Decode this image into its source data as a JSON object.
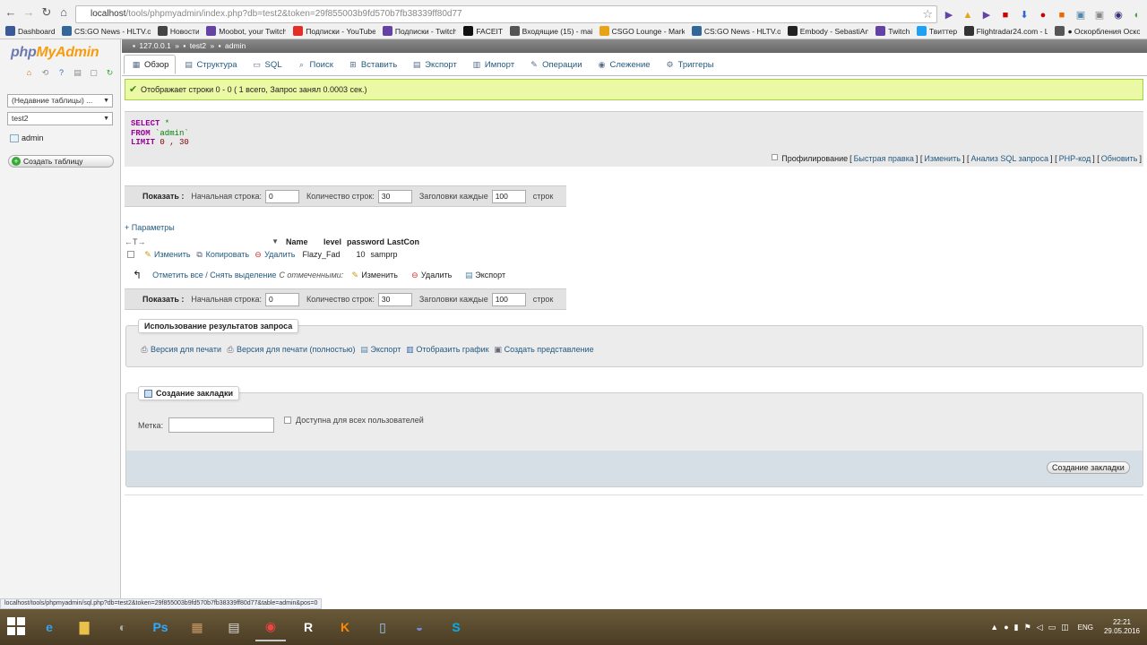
{
  "browser": {
    "url_prefix": "localhost",
    "url_suffix": "/tools/phpmyadmin/index.php?db=test2&token=29f855003b9fd570b7fb38339ff80d77",
    "bookmarks": [
      {
        "label": "Dashboard",
        "color": "#3b5998",
        "icon": "dashboard-icon"
      },
      {
        "label": "CS:GO News - HLTV.o",
        "color": "#336699",
        "icon": "hltv-icon"
      },
      {
        "label": "Новости",
        "color": "#444444",
        "icon": "news-icon"
      },
      {
        "label": "Moobot, your Twitch",
        "color": "#6441a5",
        "icon": "moobot-icon"
      },
      {
        "label": "Подписки - YouTube",
        "color": "#e52d27",
        "icon": "youtube-icon"
      },
      {
        "label": "Подписки - Twitch",
        "color": "#6441a5",
        "icon": "twitch-icon"
      },
      {
        "label": "FACEIT",
        "color": "#111111",
        "icon": "faceit-icon"
      },
      {
        "label": "Входящие (15) - mai",
        "color": "#555555",
        "icon": "mail-icon"
      },
      {
        "label": "CSGO Lounge - Mark",
        "color": "#e8a317",
        "icon": "lounge-icon"
      },
      {
        "label": "CS:GO News - HLTV.o",
        "color": "#336699",
        "icon": "hltv-icon"
      },
      {
        "label": "Embody - SebastiAn",
        "color": "#222222",
        "icon": "play-icon"
      },
      {
        "label": "Twitch",
        "color": "#6441a5",
        "icon": "twitch-icon"
      },
      {
        "label": "Твиттер",
        "color": "#1da1f2",
        "icon": "twitter-icon"
      },
      {
        "label": "Flightradar24.com - L",
        "color": "#333333",
        "icon": "radar-icon"
      },
      {
        "label": "● Оскорбления Оско",
        "color": "#555555",
        "icon": "page-icon"
      }
    ]
  },
  "left": {
    "logo_php": "php",
    "logo_my": "MyAdmin",
    "recent": "(Недавние таблицы) ...",
    "db": "test2",
    "table": "admin",
    "create_table": "Создать таблицу"
  },
  "breadcrumb": {
    "server": "127.0.0.1",
    "db": "test2",
    "table": "admin",
    "sep": "»"
  },
  "tabs": [
    {
      "label": "Обзор",
      "icon": "browse-icon",
      "active": true
    },
    {
      "label": "Структура",
      "icon": "structure-icon"
    },
    {
      "label": "SQL",
      "icon": "sql-icon"
    },
    {
      "label": "Поиск",
      "icon": "search-icon"
    },
    {
      "label": "Вставить",
      "icon": "insert-icon"
    },
    {
      "label": "Экспорт",
      "icon": "export-icon"
    },
    {
      "label": "Импорт",
      "icon": "import-icon"
    },
    {
      "label": "Операции",
      "icon": "operations-icon"
    },
    {
      "label": "Слежение",
      "icon": "tracking-icon"
    },
    {
      "label": "Триггеры",
      "icon": "triggers-icon"
    }
  ],
  "success_message": "Отображает строки 0 - 0 ( 1 всего, Запрос занял 0.0003 сек.)",
  "sql": {
    "kw_select": "SELECT",
    "select_rest": " *",
    "kw_from": "FROM",
    "from_rest": " `admin`",
    "kw_limit": "LIMIT",
    "limit_rest": " 0 , 30"
  },
  "sql_links": {
    "profiling": "Профилирование",
    "quick_edit": "Быстрая правка",
    "edit": "Изменить",
    "explain": "Анализ SQL запроса",
    "php_code": "PHP-код",
    "refresh": "Обновить"
  },
  "navbar": {
    "show": "Показать :",
    "start_label": "Начальная строка:",
    "start_value": "0",
    "rows_label": "Количество строк:",
    "rows_value": "30",
    "headers_label": "Заголовки каждые",
    "headers_value": "100",
    "rows_unit": "строк"
  },
  "params_link": "+ Параметры",
  "columns": [
    "Name",
    "level",
    "password",
    "LastCon"
  ],
  "row_actions": {
    "edit": "Изменить",
    "copy": "Копировать",
    "delete": "Удалить"
  },
  "rows": [
    {
      "name": "Flazy_Fad",
      "level": "10",
      "password": "samprp",
      "lastcon": ""
    }
  ],
  "with_selected": {
    "toggle": "Отметить все / Снять выделение",
    "label": "С отмеченными:",
    "edit": "Изменить",
    "delete": "Удалить",
    "export": "Экспорт"
  },
  "results_ops": {
    "legend": "Использование результатов запроса",
    "print": "Версия для печати",
    "print_full": "Версия для печати (полностью)",
    "export": "Экспорт",
    "chart": "Отобразить график",
    "create_view": "Создать представление"
  },
  "bookmark": {
    "legend": "Создание закладки",
    "label": "Метка:",
    "public": "Доступна для всех пользователей",
    "submit": "Создание закладки"
  },
  "status_url": "localhost/tools/phpmyadmin/sql.php?db=test2&token=29f855003b9fd570b7fb38339ff80d77&table=admin&pos=0",
  "taskbar": {
    "lang": "ENG",
    "time": "22:21",
    "date": "29.05.2016"
  }
}
